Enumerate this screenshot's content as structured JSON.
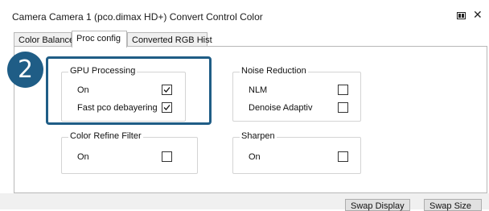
{
  "window": {
    "title": "Camera Camera 1 (pco.dimax HD+) Convert Control Color",
    "pin_icon": "pin-icon",
    "close_glyph": "✕"
  },
  "tabs": [
    {
      "label": "Color Balance",
      "active": false
    },
    {
      "label": "Proc config",
      "active": true
    },
    {
      "label": "Converted RGB Hist",
      "active": false
    }
  ],
  "annotation": {
    "badge": "2",
    "color": "#1f5d86"
  },
  "groups": {
    "gpu": {
      "title": "GPU Processing",
      "options": [
        {
          "label": "On",
          "checked": true
        },
        {
          "label": "Fast pco debayering",
          "checked": true
        }
      ]
    },
    "noise": {
      "title": "Noise Reduction",
      "options": [
        {
          "label": "NLM",
          "checked": false
        },
        {
          "label": "Denoise Adaptiv",
          "checked": false
        }
      ]
    },
    "color_refine": {
      "title": "Color Refine Filter",
      "options": [
        {
          "label": "On",
          "checked": false
        }
      ]
    },
    "sharpen": {
      "title": "Sharpen",
      "options": [
        {
          "label": "On",
          "checked": false
        }
      ]
    }
  },
  "buttons": {
    "swap_display": "Swap Display",
    "swap_size": "Swap Size"
  }
}
